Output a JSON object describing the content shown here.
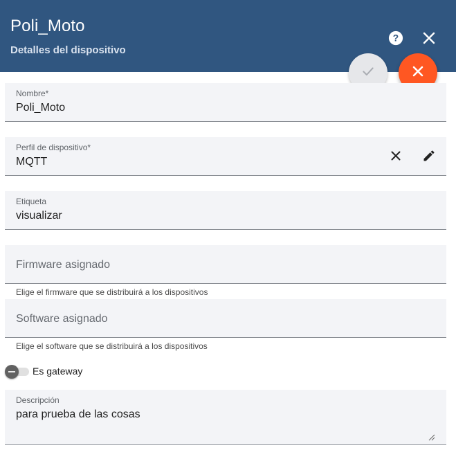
{
  "header": {
    "title": "Poli_Moto",
    "subtitle": "Detalles del dispositivo",
    "help_icon": "help-icon",
    "close_icon": "close-icon",
    "colors": {
      "background": "#305680",
      "cancel_fab": "#ff5722"
    }
  },
  "actions": {
    "save_icon": "check-icon",
    "cancel_icon": "close-icon"
  },
  "form": {
    "name": {
      "label": "Nombre*",
      "value": "Poli_Moto"
    },
    "profile": {
      "label": "Perfil de dispositivo*",
      "value": "MQTT",
      "clear_icon": "close-icon",
      "edit_icon": "pencil-icon"
    },
    "tag": {
      "label": "Etiqueta",
      "value": "visualizar"
    },
    "firmware": {
      "placeholder": "Firmware asignado",
      "hint": "Elige el firmware que se distribuirá a los dispositivos"
    },
    "software": {
      "placeholder": "Software asignado",
      "hint": "Elige el software que se distribuirá a los dispositivos"
    },
    "gateway": {
      "label": "Es gateway",
      "checked": false
    },
    "description": {
      "label": "Descripción",
      "value": "para prueba de las cosas"
    }
  }
}
